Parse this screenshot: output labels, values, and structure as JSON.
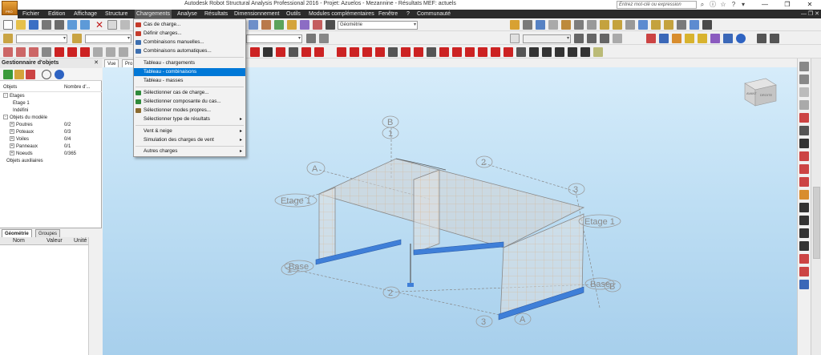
{
  "window": {
    "title": "Autodesk Robot Structural Analysis Professional 2016 - Projet: Azuelos - Mezannine - Résultats MEF: actuels",
    "search_placeholder": "Entrez mot-clé ou expression",
    "logo_text": "PRO"
  },
  "menubar": {
    "items": [
      "Fichier",
      "Edition",
      "Affichage",
      "Structure",
      "Chargements",
      "Analyse",
      "Résultats",
      "Dimensionnement",
      "Outils",
      "Modules complémentaires",
      "Fenêtre",
      "?",
      "Communauté"
    ],
    "active": "Chargements"
  },
  "toolbar": {
    "layer_combo": "Géométrie"
  },
  "objects_panel": {
    "title": "Gestionnaire d'objets",
    "col_objects": "Objets",
    "col_count": "Nombre d'...",
    "tree": [
      {
        "label": "Etages",
        "value": "",
        "level": 0
      },
      {
        "label": "Etage 1",
        "value": "",
        "level": 1
      },
      {
        "label": "Indéfini",
        "value": "",
        "level": 1
      },
      {
        "label": "Objets du modèle",
        "value": "",
        "level": 0
      },
      {
        "label": "Poutres",
        "value": "0/2",
        "level": 1
      },
      {
        "label": "Poteaux",
        "value": "0/3",
        "level": 1
      },
      {
        "label": "Voiles",
        "value": "0/4",
        "level": 1
      },
      {
        "label": "Panneaux",
        "value": "0/1",
        "level": 1
      },
      {
        "label": "Noeuds",
        "value": "0/365",
        "level": 1
      },
      {
        "label": "Objets auxiliaires",
        "value": "",
        "level": 0
      }
    ],
    "tabs": [
      "Géométrie",
      "Groupes"
    ],
    "prop_headers": [
      "Nom",
      "Valeur",
      "Unité"
    ]
  },
  "view_tabs": [
    "Vue",
    "Pro"
  ],
  "dropdown": {
    "items": [
      {
        "label": "Cas de charge...",
        "submenu": false,
        "highlight": false,
        "icon_color": "#c53b2b"
      },
      {
        "label": "Définir charges...",
        "submenu": false,
        "highlight": false,
        "icon_color": "#c53b2b"
      },
      {
        "label": "Combinaisons manuelles...",
        "submenu": false,
        "highlight": false,
        "icon_color": "#3d6fb0"
      },
      {
        "label": "Combinaisons automatiques...",
        "submenu": false,
        "highlight": false,
        "icon_color": "#3d6fb0"
      },
      {
        "label": "Tableau - chargements",
        "submenu": false,
        "highlight": false,
        "icon_color": ""
      },
      {
        "label": "Tableau - combinaisons",
        "submenu": false,
        "highlight": true,
        "icon_color": ""
      },
      {
        "label": "Tableau - masses",
        "submenu": false,
        "highlight": false,
        "icon_color": ""
      },
      {
        "label": "Sélectionner cas de charge...",
        "submenu": false,
        "highlight": false,
        "icon_color": "#2f8a3b"
      },
      {
        "label": "Sélectionner composante du cas...",
        "submenu": false,
        "highlight": false,
        "icon_color": "#2f8a3b"
      },
      {
        "label": "Sélectionner modes propres...",
        "submenu": false,
        "highlight": false,
        "icon_color": "#8a6a2f"
      },
      {
        "label": "Sélectionner type de résultats",
        "submenu": true,
        "highlight": false,
        "icon_color": ""
      },
      {
        "label": "Vent & neige",
        "submenu": true,
        "highlight": false,
        "icon_color": ""
      },
      {
        "label": "Simulation des charges de vent",
        "submenu": true,
        "highlight": false,
        "icon_color": ""
      },
      {
        "label": "Autres charges",
        "submenu": true,
        "highlight": false,
        "icon_color": ""
      }
    ]
  },
  "viewcube": {
    "front": "AVANT",
    "right": "DROITE"
  },
  "model_labels": {
    "grid_a_top": "A",
    "grid_a_bottom": "A",
    "grid_b_top": "B",
    "grid_b_bottom": "B",
    "grid_1_top": "1",
    "grid_1_left": "1",
    "grid_2_top": "2",
    "grid_2_bottom": "2",
    "grid_3_top": "3",
    "grid_3_bottom": "3",
    "etage_left": "Etage 1",
    "etage_right": "Etage 1",
    "base_left": "Base",
    "base_right": "Base"
  },
  "colors": {
    "menubar": "#2b2b2b",
    "highlight": "#0078d7",
    "viewport_top": "#d6ecfa",
    "mesh_line": "#d4883a",
    "support": "#3f7fd8"
  }
}
